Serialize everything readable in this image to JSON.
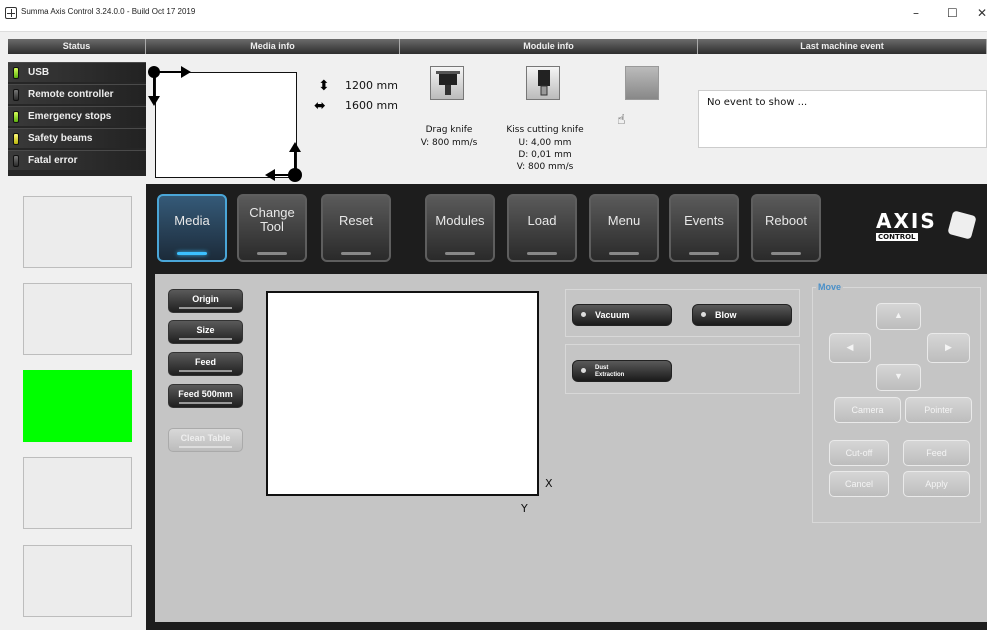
{
  "window": {
    "title": "Summa Axis Control 3.24.0.0 - Build Oct 17 2019",
    "minimize": "–",
    "maximize": "☐",
    "close": "✕"
  },
  "headers": {
    "status": "Status",
    "media_info": "Media info",
    "module_info": "Module info",
    "last_machine_event": "Last machine event"
  },
  "status": {
    "items": [
      {
        "label": "USB",
        "led": "green"
      },
      {
        "label": "Remote controller",
        "led": "off"
      },
      {
        "label": "Emergency stops",
        "led": "green"
      },
      {
        "label": "Safety beams",
        "led": "yellow"
      },
      {
        "label": "Fatal error",
        "led": "off"
      }
    ]
  },
  "media": {
    "height": "1200 mm",
    "width": "1600 mm"
  },
  "modules": [
    {
      "name": "Drag knife",
      "lines": [
        "V: 800 mm/s"
      ],
      "icon": "drag-knife-icon"
    },
    {
      "name": "Kiss cutting knife",
      "lines": [
        "U: 4,00 mm",
        "D: 0,01 mm",
        "V: 800 mm/s"
      ],
      "icon": "kiss-cutting-knife-icon"
    },
    {
      "name": "",
      "lines": [],
      "icon": "disabled-module-icon"
    }
  ],
  "event": {
    "text": "No event to show ..."
  },
  "toolbar": {
    "media": "Media",
    "change_tool_1": "Change",
    "change_tool_2": "Tool",
    "reset": "Reset",
    "modules": "Modules",
    "load": "Load",
    "menu": "Menu",
    "events": "Events",
    "reboot": "Reboot"
  },
  "logo": {
    "top": "AXIS",
    "bottom": "CONTROL"
  },
  "side_buttons": {
    "origin": "Origin",
    "size": "Size",
    "feed": "Feed",
    "feed500": "Feed 500mm",
    "clean": "Clean Table"
  },
  "axes": {
    "x": "X",
    "y": "Y"
  },
  "vacuum": {
    "vacuum": "Vacuum",
    "blow": "Blow",
    "dust_1": "Dust",
    "dust_2": "Extraction"
  },
  "move": {
    "title": "Move",
    "camera": "Camera",
    "pointer": "Pointer",
    "cutoff": "Cut-off",
    "feed": "Feed",
    "cancel": "Cancel",
    "apply": "Apply"
  },
  "colors": {
    "led_green": "#7ed321",
    "highlight_slot": "#00ff00",
    "active_accent": "#3cc1ff",
    "move_title": "#4a90c9"
  }
}
